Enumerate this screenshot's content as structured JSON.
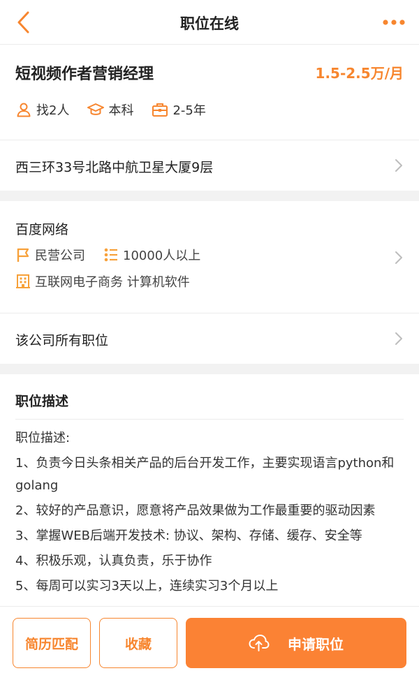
{
  "nav": {
    "title": "职位在线",
    "back_icon": "chevron-left-icon",
    "more_icon": "more-dots-icon"
  },
  "job": {
    "title": "短视频作者营销经理",
    "salary": "1.5-2.5万/月",
    "meta": [
      {
        "icon": "person-icon",
        "text": "找2人"
      },
      {
        "icon": "graduation-cap-icon",
        "text": "本科"
      },
      {
        "icon": "briefcase-icon",
        "text": "2-5年"
      }
    ]
  },
  "address": "西三环33号北路中航卫星大厦9层",
  "company": {
    "name": "百度网络",
    "type": "民营公司",
    "size": "10000人以上",
    "industry": "互联网电子商务 计算机软件"
  },
  "all_jobs": "该公司所有职位",
  "description": {
    "title": "职位描述",
    "lines": [
      "职位描述:",
      "1、负责今日头条相关产品的后台开发工作，主要实现语言python和golang",
      "2、较好的产品意识，愿意将产品效果做为工作最重要的驱动因素",
      "3、掌握WEB后端开发技术: 协议、架构、存储、缓存、安全等",
      "4、积极乐观，认真负责，乐于协作",
      "5、每周可以实习3天以上，连续实习3个月以上"
    ]
  },
  "actions": {
    "resume_match": "简历匹配",
    "favorite": "收藏",
    "apply": "申请职位"
  },
  "colors": {
    "accent": "#f7862f",
    "primary_button": "#fb8234",
    "section_gap": "#f2f2f2"
  }
}
